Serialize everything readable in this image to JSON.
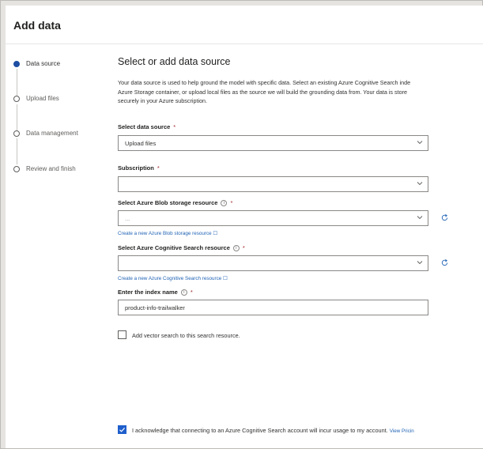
{
  "dialog": {
    "title": "Add data"
  },
  "steps": [
    {
      "label": "Data source",
      "active": true
    },
    {
      "label": "Upload files",
      "active": false
    },
    {
      "label": "Data management",
      "active": false
    },
    {
      "label": "Review and finish",
      "active": false
    }
  ],
  "main": {
    "heading": "Select or add data source",
    "description": [
      "Your data source is used to help ground the model with specific data. Select an existing Azure Cognitive Search inde",
      "Azure Storage container, or upload local files as the source we will build the grounding data from. Your data is store",
      "securely in your Azure subscription."
    ],
    "data_source": {
      "label": "Select data source",
      "required": "*",
      "value": "Upload files"
    },
    "subscription": {
      "label": "Subscription",
      "required": "*",
      "value": ""
    },
    "blob": {
      "label": "Select Azure Blob storage resource",
      "required": "*",
      "value": "...",
      "create_link": "Create a new Azure Blob storage resource ☐"
    },
    "search": {
      "label": "Select Azure Cognitive Search resource",
      "required": "*",
      "value": "",
      "create_link": "Create a new Azure Cognitive Search resource ☐"
    },
    "index_name": {
      "label": "Enter the index name",
      "required": "*",
      "value": "product-info-trailwalker"
    },
    "vector_search": {
      "label": "Add vector search to this search resource.",
      "checked": false
    },
    "acknowledge": {
      "label": "I acknowledge that connecting to an Azure Cognitive Search account will incur usage to my account.",
      "link": "View Pricin",
      "checked": true
    }
  },
  "icons": {
    "chevron": "chevron-down-icon",
    "refresh": "refresh-icon",
    "info": "info-icon",
    "check": "checkmark-icon"
  },
  "colors": {
    "accent": "#1f5fcc",
    "link": "#1f62b4",
    "required": "#a4262c"
  }
}
